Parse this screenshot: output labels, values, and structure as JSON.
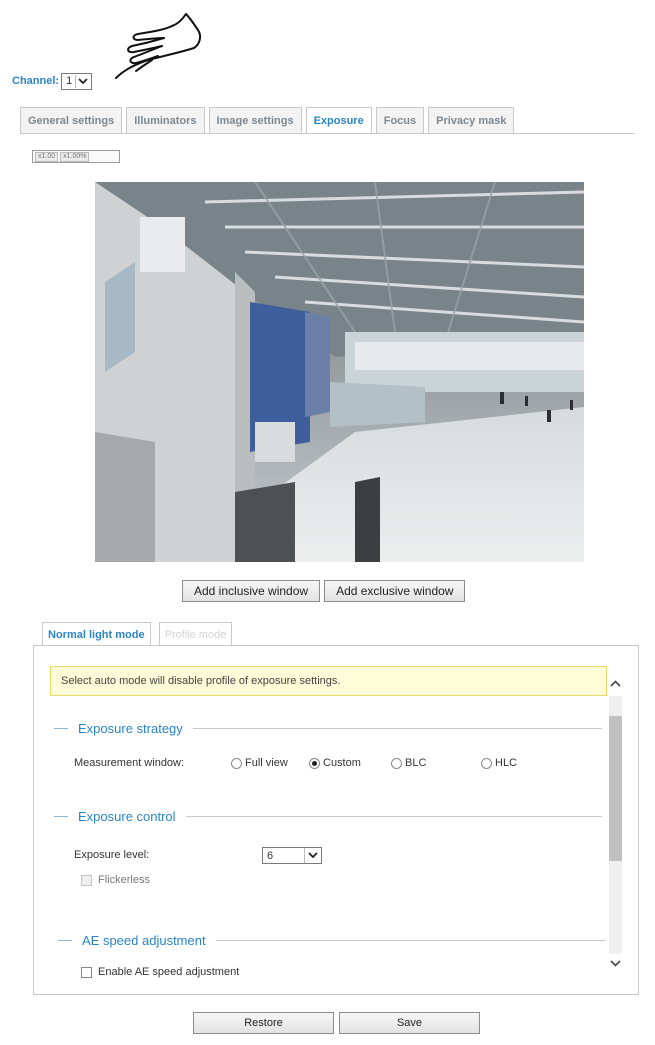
{
  "channel": {
    "label": "Channel:",
    "value": "1"
  },
  "tabs": [
    {
      "label": "General settings",
      "active": false
    },
    {
      "label": "Illuminators",
      "active": false
    },
    {
      "label": "Image settings",
      "active": false
    },
    {
      "label": "Exposure",
      "active": true
    },
    {
      "label": "Focus",
      "active": false
    },
    {
      "label": "Privacy mask",
      "active": false
    }
  ],
  "zoom": {
    "a": "x1.00",
    "b": "x1.00%"
  },
  "window_buttons": {
    "inclusive": "Add inclusive window",
    "exclusive": "Add exclusive window"
  },
  "mode_tabs": {
    "normal": "Normal light mode",
    "profile": "Profile mode"
  },
  "notice": "Select auto mode will disable profile of exposure settings.",
  "exposure_strategy": {
    "title": "Exposure strategy",
    "measurement_label": "Measurement window:",
    "options": [
      {
        "label": "Full view",
        "selected": false
      },
      {
        "label": "Custom",
        "selected": true
      },
      {
        "label": "BLC",
        "selected": false
      },
      {
        "label": "HLC",
        "selected": false
      }
    ]
  },
  "exposure_control": {
    "title": "Exposure control",
    "level_label": "Exposure level:",
    "level_value": "6",
    "flickerless_label": "Flickerless"
  },
  "ae_speed": {
    "title": "AE speed adjustment",
    "enable_label": "Enable AE speed adjustment"
  },
  "footer": {
    "restore": "Restore",
    "save": "Save"
  },
  "colors": {
    "accent": "#2a84c7",
    "notice_bg": "#fdfbd8",
    "border": "#c9c9c9"
  }
}
